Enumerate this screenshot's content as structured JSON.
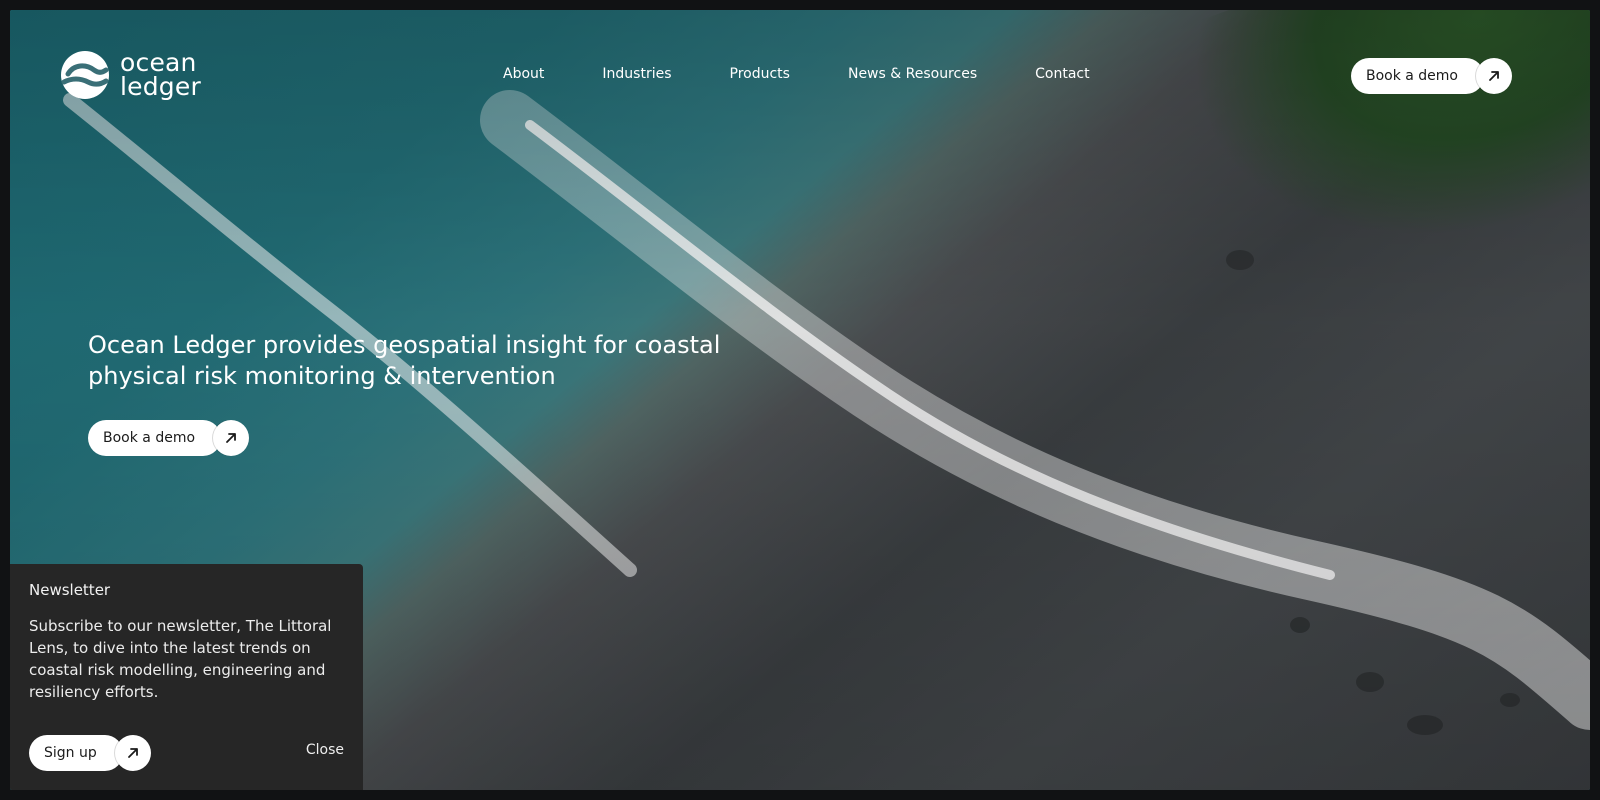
{
  "brand": {
    "line1": "ocean",
    "line2": "ledger"
  },
  "nav": {
    "items": [
      "About",
      "Industries",
      "Products",
      "News & Resources",
      "Contact"
    ]
  },
  "header": {
    "cta_label": "Book a demo"
  },
  "hero": {
    "headline": "Ocean Ledger provides geospatial insight for coastal physical risk monitoring & intervention",
    "cta_label": "Book a demo"
  },
  "newsletter": {
    "title": "Newsletter",
    "body": "Subscribe to our newsletter, The Littoral Lens, to dive into the latest trends on coastal risk modelling, engineering and resiliency efforts.",
    "signup_label": "Sign up",
    "close_label": "Close"
  },
  "colors": {
    "panel": "#262626",
    "ocean": "#226f78",
    "rock": "#3b3f42"
  }
}
